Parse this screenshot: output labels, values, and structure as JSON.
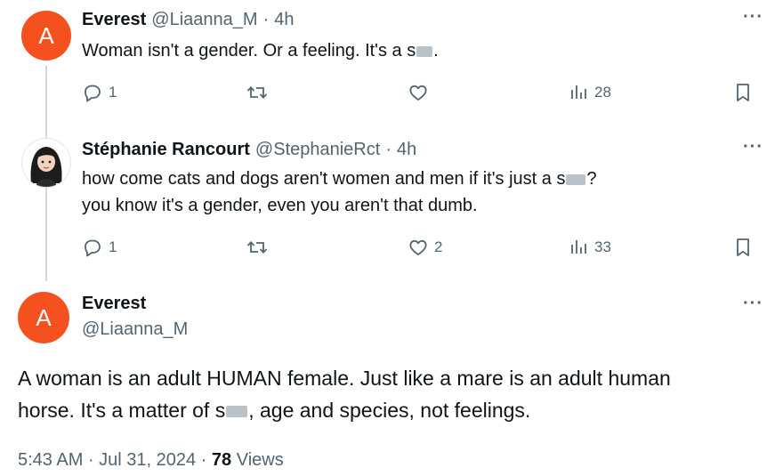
{
  "tweets": [
    {
      "avatar_letter": "A",
      "avatar_color": "#f4511e",
      "name": "Everest",
      "handle": "@Liaanna_M",
      "time": "4h",
      "text_before": "Woman isn't a gender. Or a feeling. It's a s",
      "text_after": ".",
      "replies": "1",
      "views": "28"
    },
    {
      "name": "Stéphanie Rancourt",
      "handle": "@StephanieRct",
      "time": "4h",
      "line1_before": "how come cats and dogs aren't women and men if it's just a s",
      "line1_after": "?",
      "line2": "you know it's a gender, even you aren't that dumb.",
      "replies": "1",
      "likes": "2",
      "views": "33"
    }
  ],
  "main_tweet": {
    "avatar_letter": "A",
    "avatar_color": "#f4511e",
    "name": "Everest",
    "handle": "@Liaanna_M",
    "line1": "A woman is an adult HUMAN female. Just like a mare is an adult human",
    "line2_before": "horse. It's a matter of s",
    "line2_after": ", age and species, not feelings.",
    "timestamp": "5:43 AM · Jul 31, 2024 · ",
    "views_count": "78",
    "views_label": " Views"
  },
  "separator": "·",
  "more_icon": "more-horizontal-icon",
  "colors": {
    "accent_gray": "#536471",
    "thread_line": "#cfd9de",
    "avatar_orange": "#f4511e"
  }
}
